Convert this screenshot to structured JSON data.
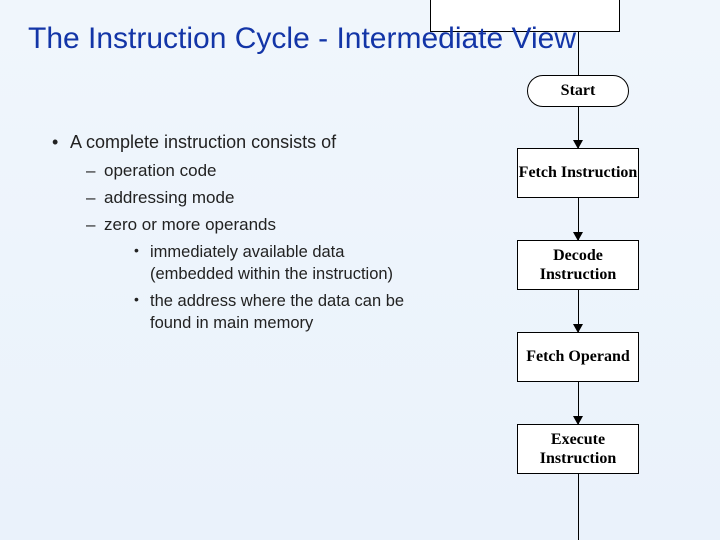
{
  "title": "The Instruction Cycle - Intermediate View",
  "bullets": {
    "l1_1": "A complete instruction consists of",
    "l2_1": "operation code",
    "l2_2": "addressing mode",
    "l2_3": "zero or more operands",
    "l3_1": "immediately available data (embedded within the instruction)",
    "l3_2": "the address where the data can be found in main memory"
  },
  "flow": {
    "start": "Start",
    "fetch_instruction": "Fetch Instruction",
    "decode_instruction": "Decode Instruction",
    "fetch_operand": "Fetch Operand",
    "execute_instruction": "Execute Instruction"
  }
}
